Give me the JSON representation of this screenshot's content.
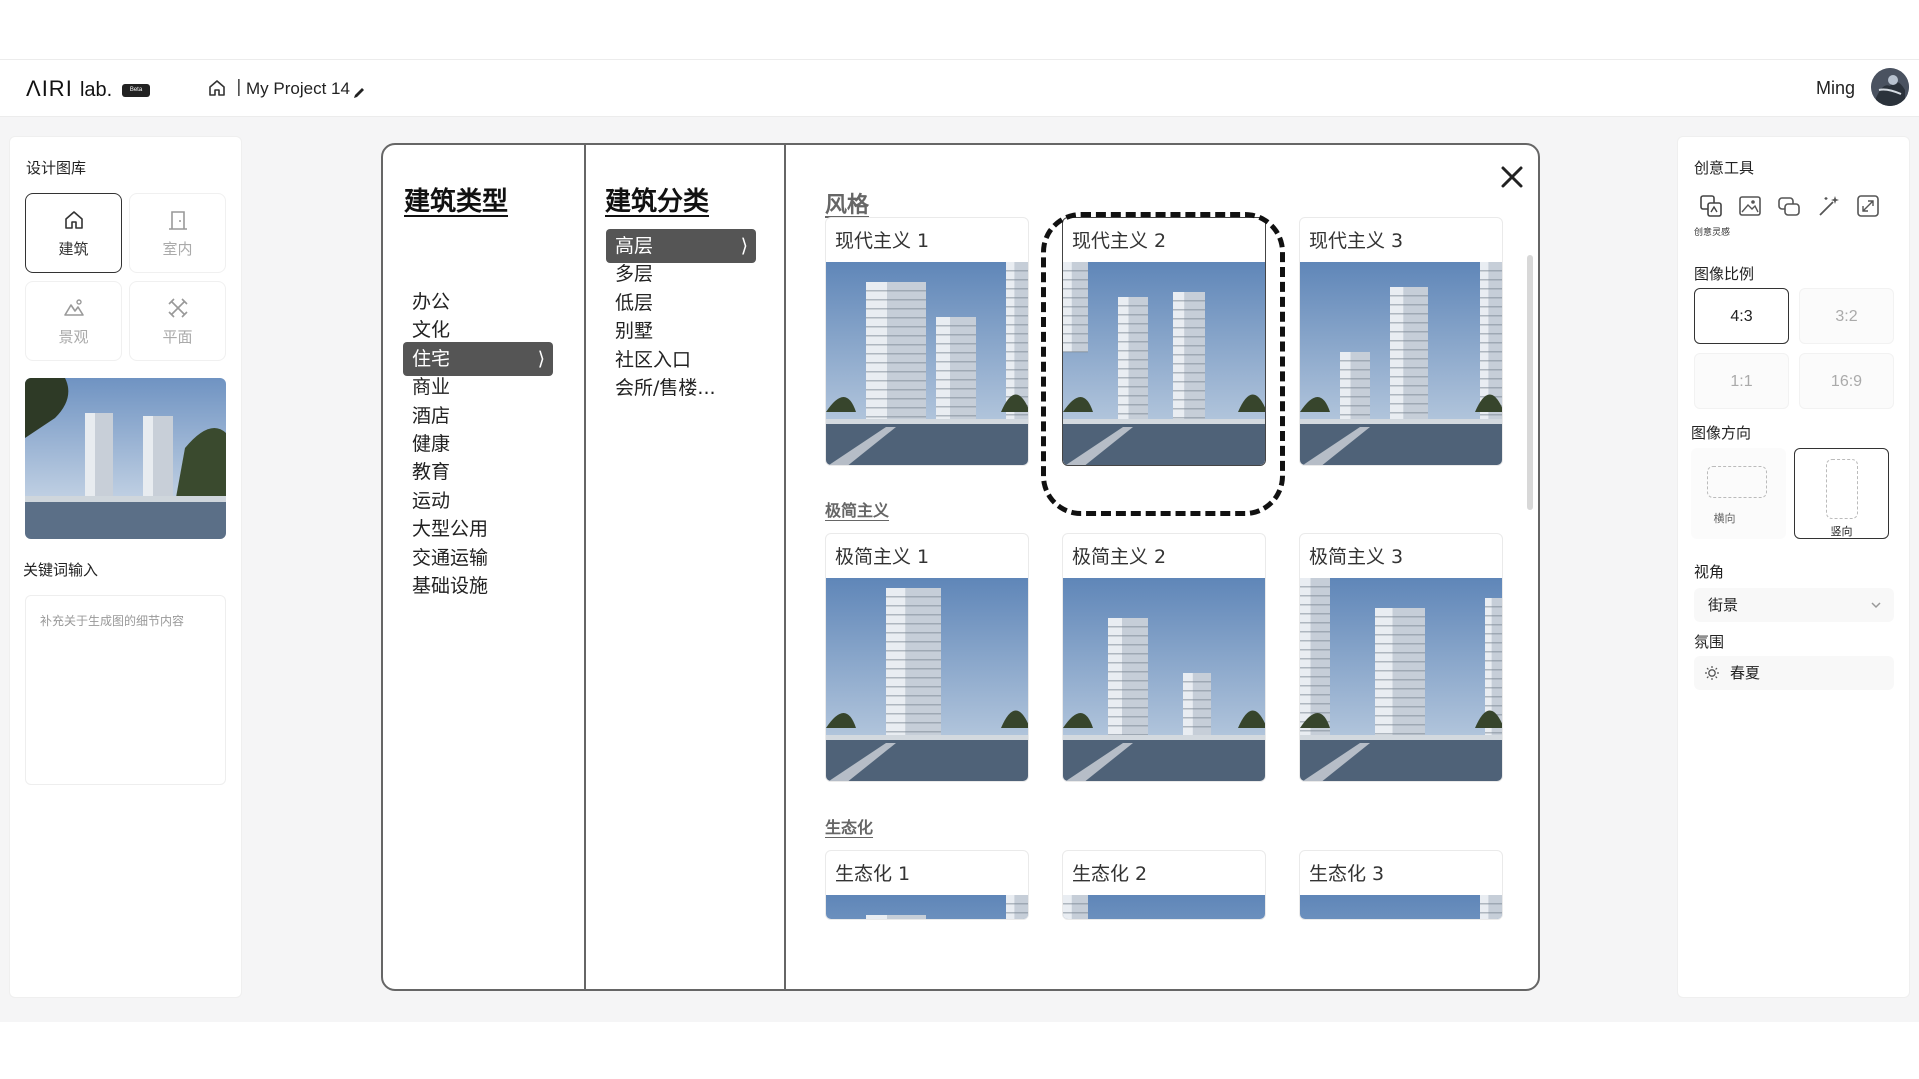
{
  "header": {
    "logo": "ΛIRI",
    "logo_suffix": "lab.",
    "beta_badge": "Beta",
    "breadcrumb_sep": "|",
    "project_name": "My Project 14",
    "user_name": "Ming"
  },
  "left_panel": {
    "library_title": "设计图库",
    "tiles": [
      {
        "label": "建筑",
        "icon": "home-icon",
        "active": true
      },
      {
        "label": "室内",
        "icon": "door-icon",
        "active": false
      },
      {
        "label": "景观",
        "icon": "landscape-icon",
        "active": false
      },
      {
        "label": "平面",
        "icon": "plan-icon",
        "active": false
      }
    ],
    "keyword_title": "关键词输入",
    "keyword_placeholder": "补充关于生成图的细节内容"
  },
  "right_panel": {
    "tools_title": "创意工具",
    "tool_caption": "创意灵感",
    "tools": [
      "translate-image-icon",
      "image-icon",
      "chat-image-icon",
      "magic-wand-icon",
      "expand-icon"
    ],
    "ratio_title": "图像比例",
    "ratios": [
      {
        "label": "4:3",
        "active": true
      },
      {
        "label": "3:2",
        "active": false
      },
      {
        "label": "1:1",
        "active": false
      },
      {
        "label": "16:9",
        "active": false
      }
    ],
    "orientation_title": "图像方向",
    "orientations": [
      {
        "label": "横向",
        "active": false
      },
      {
        "label": "竖向",
        "active": true
      }
    ],
    "view_title": "视角",
    "view_value": "街景",
    "mood_title": "氛围",
    "mood_value": "春夏"
  },
  "modal": {
    "type_title": "建筑类型",
    "types": [
      {
        "label": "办公",
        "active": false
      },
      {
        "label": "文化",
        "active": false
      },
      {
        "label": "住宅",
        "active": true
      },
      {
        "label": "商业",
        "active": false
      },
      {
        "label": "酒店",
        "active": false
      },
      {
        "label": "健康",
        "active": false
      },
      {
        "label": "教育",
        "active": false
      },
      {
        "label": "运动",
        "active": false
      },
      {
        "label": "大型公用",
        "active": false
      },
      {
        "label": "交通运输",
        "active": false
      },
      {
        "label": "基础设施",
        "active": false
      }
    ],
    "class_title": "建筑分类",
    "classes": [
      {
        "label": "高层",
        "active": true
      },
      {
        "label": "多层",
        "active": false
      },
      {
        "label": "低层",
        "active": false
      },
      {
        "label": "别墅",
        "active": false
      },
      {
        "label": "社区入口",
        "active": false
      },
      {
        "label": "会所/售楼...",
        "active": false
      }
    ],
    "active_arrow": "⟩",
    "style_title": "风格",
    "sections": [
      {
        "heading": "",
        "cards": [
          "现代主义 1",
          "现代主义 2",
          "现代主义 3"
        ],
        "selected": 1
      },
      {
        "heading": "极简主义",
        "cards": [
          "极简主义 1",
          "极简主义 2",
          "极简主义 3"
        ],
        "selected": -1
      },
      {
        "heading": "生态化",
        "cards": [
          "生态化 1",
          "生态化 2",
          "生态化 3"
        ],
        "selected": -1
      }
    ]
  },
  "colors": {
    "accent_dark": "#555555",
    "border": "#666666",
    "sky_top": "#5f86b8",
    "sky_bottom": "#c9d7e6"
  }
}
